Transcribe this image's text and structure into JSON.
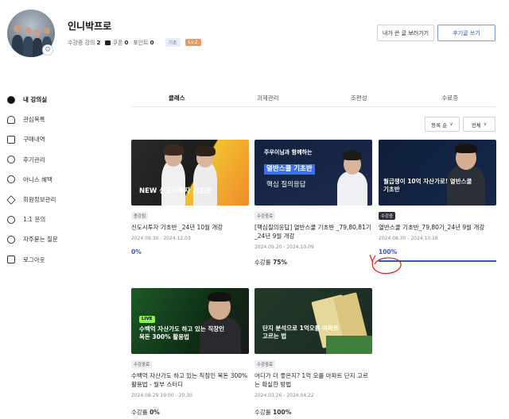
{
  "profile": {
    "name": "인니박프로",
    "stats": [
      {
        "label": "수강중 강의",
        "value": "2"
      },
      {
        "label": "쿠폰",
        "value": "0"
      },
      {
        "label": "포인트",
        "value": "0"
      }
    ],
    "tags": [
      "기초",
      "Lv.2"
    ]
  },
  "header_buttons": {
    "my_posts": "내가 쓴 글 보러가기",
    "review_write": "후기글 쓰기"
  },
  "sidebar": {
    "items": [
      {
        "label": "내 강의실",
        "icon": "play-circle-icon",
        "active": true
      },
      {
        "label": "관심목록",
        "icon": "heart-icon",
        "active": false
      },
      {
        "label": "구매내역",
        "icon": "receipt-icon",
        "active": false
      },
      {
        "label": "후기관리",
        "icon": "speech-bubble-icon",
        "active": false
      },
      {
        "label": "아니스 혜택",
        "icon": "medal-icon",
        "active": false
      },
      {
        "label": "회원정보관리",
        "icon": "settings-icon",
        "active": false
      },
      {
        "label": "1:1 문의",
        "icon": "chat-icon",
        "active": false
      },
      {
        "label": "자주묻는 질문",
        "icon": "question-icon",
        "active": false
      },
      {
        "label": "로그아웃",
        "icon": "logout-icon",
        "active": false
      }
    ]
  },
  "tabs": [
    {
      "label": "클래스",
      "active": true
    },
    {
      "label": "과제관리",
      "active": false
    },
    {
      "label": "조편성",
      "active": false
    },
    {
      "label": "수료증",
      "active": false
    }
  ],
  "filters": {
    "sort": "등록 순",
    "scope": "전체"
  },
  "cards": [
    {
      "thumb_text": "NEW 신도시투자 기초반",
      "badge": "종강됨",
      "title": "신도시투자 기초반 _24년 10월 개강",
      "dates": "2024.09.30 - 2024.12.03",
      "progress_label": "",
      "progress_value": "0%",
      "progress": 0
    },
    {
      "thumb_text_top": "주우이님과 함께하는",
      "thumb_text_mid": "열반스쿨 기초반",
      "thumb_text_bot": "핵심 질의응답",
      "badge": "수강중료",
      "title": "[핵심질의응답] 열반스쿨 기초반 _79,80,81기_24년 9월 개강",
      "dates": "2024.09.20 - 2024.10.09",
      "progress_label": "수강률",
      "progress_value": "75%",
      "progress": 0.75
    },
    {
      "thumb_text": "월급쟁이 10억 자산가로! 열반스쿨 기초반",
      "badge": "수강중",
      "title": "열반스쿨 기초반_79,80기_24년 9월 개강",
      "dates": "2024.08.30 - 2024.10.16",
      "progress_label": "",
      "progress_value": "100%",
      "progress": 1.0
    },
    {
      "live": "LIVE",
      "thumb_text": "수백억 자산가도 하고 있는 직장인 목돈 300% 활용법",
      "badge": "수강중료",
      "title": "수백억 자산가도 하고 있는 직장인 목돈 300% 활용법 - 월부 스터디",
      "dates": "2024.08.29 19:00 - 20:30",
      "progress_label": "수강률",
      "progress_value": "0%",
      "progress": 0
    },
    {
      "thumb_text": "단지 분석으로 1억오를 아파트 고르는 법",
      "badge": "수강중료",
      "title": "어디가 더 좋은지? 1억 오를 아파트 단지 고르는 확실한 방법",
      "dates": "2024.03.26 - 2024.04.22",
      "progress_label": "수강률",
      "progress_value": "100%",
      "progress": 1.0
    }
  ],
  "colors": {
    "accent": "#2f5bb7",
    "annotation": "#e0201c"
  }
}
